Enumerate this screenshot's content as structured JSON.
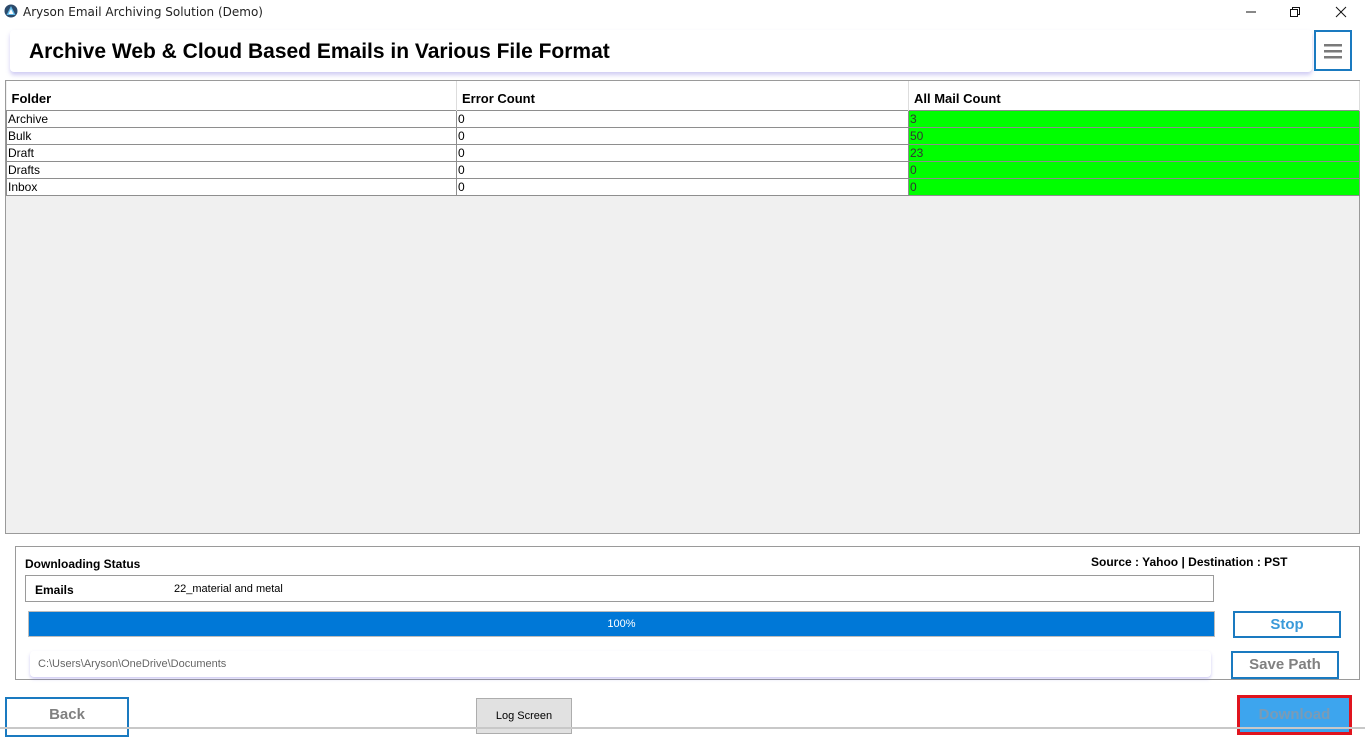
{
  "window": {
    "title": "Aryson Email Archiving Solution (Demo)",
    "controls": [
      "minimize",
      "maximize",
      "close"
    ]
  },
  "header": {
    "title": "Archive Web & Cloud Based Emails in Various File Format",
    "menu_icon": "hamburger-menu-icon"
  },
  "grid": {
    "columns": [
      "Folder",
      "Error Count",
      "All Mail Count"
    ],
    "rows": [
      {
        "folder": "Archive",
        "error_count": "0",
        "all_mail_count": "3"
      },
      {
        "folder": "Bulk",
        "error_count": "0",
        "all_mail_count": "50"
      },
      {
        "folder": "Draft",
        "error_count": "0",
        "all_mail_count": "23"
      },
      {
        "folder": "Drafts",
        "error_count": "0",
        "all_mail_count": "0"
      },
      {
        "folder": "Inbox",
        "error_count": "0",
        "all_mail_count": "0"
      }
    ],
    "highlight_color": "#00ff00"
  },
  "status": {
    "label": "Downloading Status",
    "source_destination": "Source : Yahoo | Destination : PST",
    "emails_label": "Emails",
    "emails_value": "22_material and metal",
    "progress_percent": 100,
    "progress_text": "100%",
    "save_path": "C:\\Users\\Aryson\\OneDrive\\Documents",
    "stop_label": "Stop",
    "save_path_label": "Save Path"
  },
  "footer": {
    "back_label": "Back",
    "log_label": "Log Screen",
    "download_label": "Download"
  },
  "colors": {
    "accent": "#1a7ac0",
    "progress": "#0078d7",
    "download_bg": "#3da5ee",
    "download_border": "#e0141e"
  }
}
